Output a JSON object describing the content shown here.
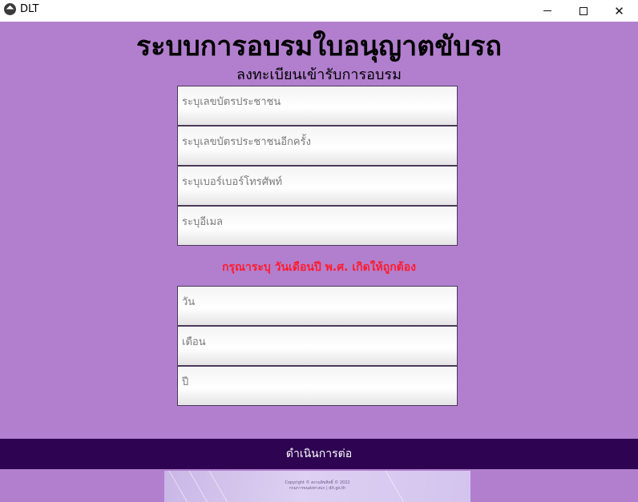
{
  "window": {
    "title": "DLT",
    "icon": "app-logo-icon",
    "controls": [
      "minimize-icon",
      "maximize-icon",
      "close-icon"
    ]
  },
  "header": {
    "title": "ระบบการอบรมใบอนุญาตขับรถ",
    "subtitle": "ลงทะเบียนเข้ารับการอบรม"
  },
  "form": {
    "id_card_placeholder": "ระบุเลขบัตรประชาชน",
    "id_card_confirm_placeholder": "ระบุเลขบัตรประชาชนอีกครั้ง",
    "phone_placeholder": "ระบุเบอร์เบอร์โทรศัพท์",
    "email_placeholder": "ระบุอีเมล",
    "birthdate_notice": "กรุณาระบุ วันเดือนปี พ.ศ. เกิดให้ถูกต้อง",
    "day_placeholder": "วัน",
    "month_placeholder": "เดือน",
    "year_placeholder": "ปี",
    "submit_label": "ดำเนินการต่อ"
  },
  "footer": {
    "line1": "Copyright © สงวนลิขสิทธิ์ © 2022",
    "line2": "กรมการขนส่งทางบก | dlt.go.th"
  },
  "colors": {
    "background": "#b27fce",
    "button": "#2e0352",
    "notice": "#ff1b2d"
  }
}
